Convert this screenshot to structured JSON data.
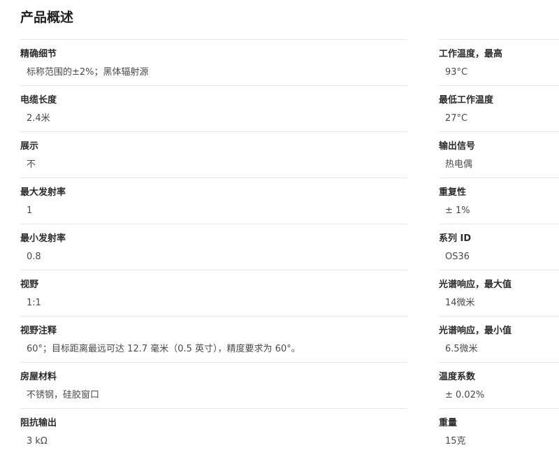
{
  "title": "产品概述",
  "left_specs": [
    {
      "label": "精确细节",
      "value": "标称范围的±2%；黑体辐射源"
    },
    {
      "label": "电缆长度",
      "value": "2.4米"
    },
    {
      "label": "展示",
      "value": "不"
    },
    {
      "label": "最大发射率",
      "value": "1"
    },
    {
      "label": "最小发射率",
      "value": "0.8"
    },
    {
      "label": "视野",
      "value": "1:1"
    },
    {
      "label": "视野注释",
      "value": "60°；目标距离最远可达 12.7 毫米（0.5 英寸），精度要求为 60°。"
    },
    {
      "label": "房屋材料",
      "value": "不锈钢，硅胶窗口"
    },
    {
      "label": "阻抗输出",
      "value": "3 kΩ"
    }
  ],
  "right_specs": [
    {
      "label": "工作温度，最高",
      "value": "93°C"
    },
    {
      "label": "最低工作温度",
      "value": "27°C"
    },
    {
      "label": "输出信号",
      "value": "热电偶"
    },
    {
      "label": "重复性",
      "value": "± 1%"
    },
    {
      "label": "系列 ID",
      "value": "OS36"
    },
    {
      "label": "光谱响应，最大值",
      "value": "14微米"
    },
    {
      "label": "光谱响应，最小值",
      "value": "6.5微米"
    },
    {
      "label": "温度系数",
      "value": "± 0.02%"
    },
    {
      "label": "重量",
      "value": "15克"
    }
  ]
}
